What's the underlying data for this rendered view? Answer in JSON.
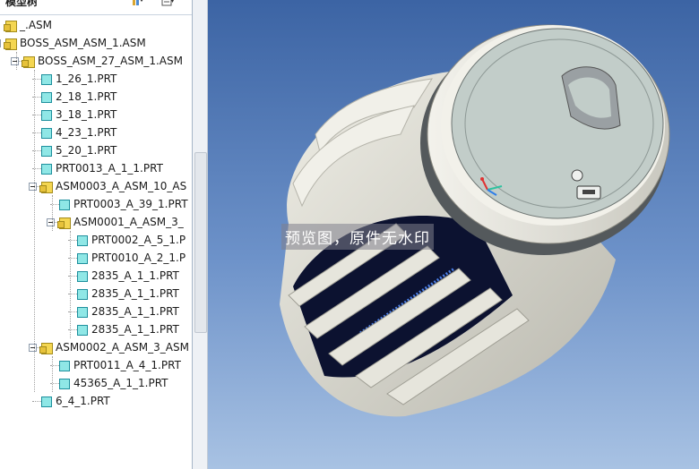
{
  "panel": {
    "title": "模型树"
  },
  "tree": {
    "items": [
      {
        "label": "_.ASM",
        "type": "asm",
        "level": 0,
        "expanded": false
      },
      {
        "label": "BOSS_ASM_ASM_1.ASM",
        "type": "asm",
        "level": 0,
        "expanded": true
      },
      {
        "label": "BOSS_ASM_27_ASM_1.ASM",
        "type": "asm",
        "level": 1,
        "expanded": true
      },
      {
        "label": "1_26_1.PRT",
        "type": "prt",
        "level": 2
      },
      {
        "label": "2_18_1.PRT",
        "type": "prt",
        "level": 2
      },
      {
        "label": "3_18_1.PRT",
        "type": "prt",
        "level": 2
      },
      {
        "label": "4_23_1.PRT",
        "type": "prt",
        "level": 2
      },
      {
        "label": "5_20_1.PRT",
        "type": "prt",
        "level": 2
      },
      {
        "label": "PRT0013_A_1_1.PRT",
        "type": "prt",
        "level": 2
      },
      {
        "label": "ASM0003_A_ASM_10_AS",
        "type": "asm",
        "level": 2,
        "expanded": true
      },
      {
        "label": "PRT0003_A_39_1.PRT",
        "type": "prt",
        "level": 3
      },
      {
        "label": "ASM0001_A_ASM_3_",
        "type": "asm",
        "level": 3,
        "expanded": true
      },
      {
        "label": "PRT0002_A_5_1.P",
        "type": "prt",
        "level": 4
      },
      {
        "label": "PRT0010_A_2_1.P",
        "type": "prt",
        "level": 4
      },
      {
        "label": "2835_A_1_1.PRT",
        "type": "prt",
        "level": 4
      },
      {
        "label": "2835_A_1_1.PRT",
        "type": "prt",
        "level": 4
      },
      {
        "label": "2835_A_1_1.PRT",
        "type": "prt",
        "level": 4
      },
      {
        "label": "2835_A_1_1.PRT",
        "type": "prt",
        "level": 4
      },
      {
        "label": "ASM0002_A_ASM_3_ASM",
        "type": "asm",
        "level": 2,
        "expanded": true
      },
      {
        "label": "PRT0011_A_4_1.PRT",
        "type": "prt",
        "level": 3
      },
      {
        "label": "45365_A_1_1.PRT",
        "type": "prt",
        "level": 3
      },
      {
        "label": "6_4_1.PRT",
        "type": "prt",
        "level": 2
      }
    ]
  },
  "viewport": {
    "watermark": "预览图，原件无水印"
  },
  "colors": {
    "viewport_top": "#3c64a4",
    "viewport_bottom": "#a8c2e3",
    "asm_icon": "#f4d651",
    "prt_icon": "#8fe7e6",
    "model_body": "#d9d8cf",
    "model_cap": "#c2cdc9"
  }
}
